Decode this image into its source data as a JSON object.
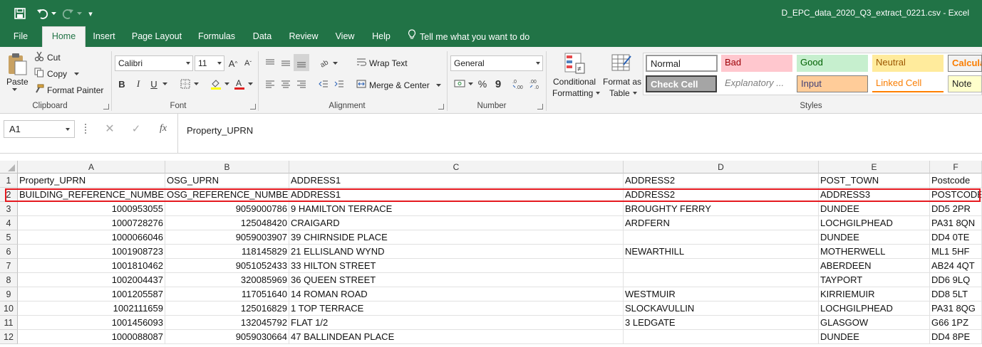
{
  "window": {
    "title": "D_EPC_data_2020_Q3_extract_0221.csv  -  Excel"
  },
  "quick_access": {
    "customize_symbol": "▾"
  },
  "tabs": [
    {
      "label": "File"
    },
    {
      "label": "Home"
    },
    {
      "label": "Insert"
    },
    {
      "label": "Page Layout"
    },
    {
      "label": "Formulas"
    },
    {
      "label": "Data"
    },
    {
      "label": "Review"
    },
    {
      "label": "View"
    },
    {
      "label": "Help"
    },
    {
      "label": "Tell me what you want to do"
    }
  ],
  "ribbon": {
    "clipboard": {
      "paste": "Paste",
      "cut": "Cut",
      "copy": "Copy",
      "format_painter": "Format Painter",
      "label": "Clipboard"
    },
    "font": {
      "font_name": "Calibri",
      "font_size": "11",
      "bold": "B",
      "italic": "I",
      "underline": "U",
      "label": "Font"
    },
    "alignment": {
      "wrap_text": "Wrap Text",
      "merge_center": "Merge & Center",
      "label": "Alignment"
    },
    "number": {
      "format": "General",
      "percent": "%",
      "comma": "9",
      "label": "Number"
    },
    "styles": {
      "conditional_formatting_1": "Conditional",
      "conditional_formatting_2": "Formatting",
      "format_as_table_1": "Format as",
      "format_as_table_2": "Table",
      "normal": "Normal",
      "bad": "Bad",
      "good": "Good",
      "neutral": "Neutral",
      "calculation": "Calcula",
      "check_cell": "Check Cell",
      "explanatory": "Explanatory ...",
      "input": "Input",
      "linked_cell": "Linked Cell",
      "note": "Note",
      "label": "Styles"
    }
  },
  "formula_bar": {
    "name_box": "A1",
    "fx": "fx",
    "value": "Property_UPRN"
  },
  "grid": {
    "columns": [
      "A",
      "B",
      "C",
      "D",
      "E",
      "F"
    ],
    "rows": [
      {
        "n": "1",
        "cells": [
          "Property_UPRN",
          "OSG_UPRN",
          "ADDRESS1",
          "ADDRESS2",
          "POST_TOWN",
          "Postcode"
        ]
      },
      {
        "n": "2",
        "cells": [
          "BUILDING_REFERENCE_NUMBER",
          "OSG_REFERENCE_NUMBER",
          "ADDRESS1",
          "ADDRESS2",
          "ADDRESS3",
          "POSTCODE"
        ]
      },
      {
        "n": "3",
        "cells": [
          "1000953055",
          "9059000786",
          "9 HAMILTON TERRACE",
          "BROUGHTY FERRY",
          "DUNDEE",
          "DD5 2PR"
        ]
      },
      {
        "n": "4",
        "cells": [
          "1000728276",
          "125048420",
          "CRAIGARD",
          "ARDFERN",
          "LOCHGILPHEAD",
          "PA31 8QN"
        ]
      },
      {
        "n": "5",
        "cells": [
          "1000066046",
          "9059003907",
          "39 CHIRNSIDE PLACE",
          "",
          "DUNDEE",
          "DD4 0TE"
        ]
      },
      {
        "n": "6",
        "cells": [
          "1001908723",
          "118145829",
          "21 ELLISLAND WYND",
          "NEWARTHILL",
          "MOTHERWELL",
          "ML1 5HF"
        ]
      },
      {
        "n": "7",
        "cells": [
          "1001810462",
          "9051052433",
          "33 HILTON STREET",
          "",
          "ABERDEEN",
          "AB24 4QT"
        ]
      },
      {
        "n": "8",
        "cells": [
          "1002004437",
          "320085969",
          "36 QUEEN STREET",
          "",
          "TAYPORT",
          "DD6 9LQ"
        ]
      },
      {
        "n": "9",
        "cells": [
          "1001205587",
          "117051640",
          "14 ROMAN ROAD",
          "WESTMUIR",
          "KIRRIEMUIR",
          "DD8 5LT"
        ]
      },
      {
        "n": "10",
        "cells": [
          "1002111659",
          "125016829",
          "1 TOP TERRACE",
          "SLOCKAVULLIN",
          "LOCHGILPHEAD",
          "PA31 8QG"
        ]
      },
      {
        "n": "11",
        "cells": [
          "1001456093",
          "132045792",
          "FLAT 1/2",
          "3 LEDGATE",
          "GLASGOW",
          "G66 1PZ"
        ]
      },
      {
        "n": "12",
        "cells": [
          "1000088087",
          "9059030664",
          "47 BALLINDEAN PLACE",
          "",
          "DUNDEE",
          "DD4 8PE"
        ]
      }
    ]
  },
  "colors": {
    "excel_green": "#217346",
    "highlight_red": "#e5191f"
  }
}
